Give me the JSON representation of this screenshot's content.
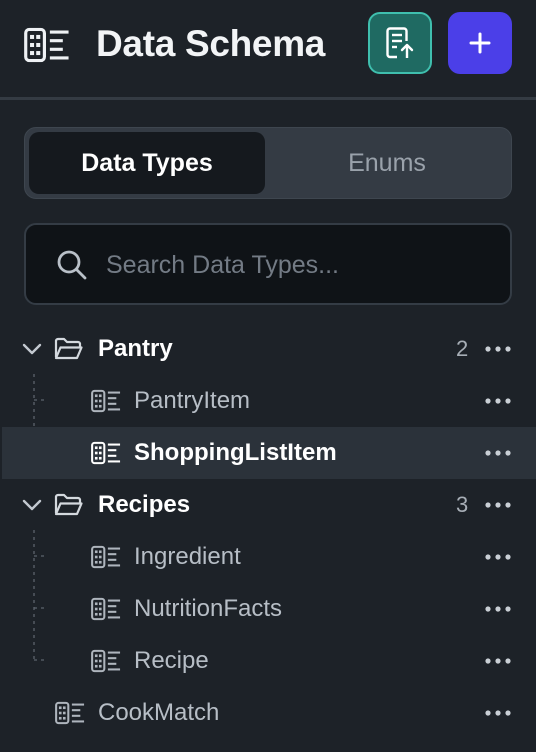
{
  "header": {
    "title": "Data Schema",
    "upload_icon": "document-upload-icon",
    "add_icon": "plus-icon",
    "accent_add": "#4b3fe8",
    "accent_upload": "#3fbfae"
  },
  "tabs": [
    {
      "label": "Data Types",
      "active": true
    },
    {
      "label": "Enums",
      "active": false
    }
  ],
  "search": {
    "placeholder": "Search Data Types...",
    "value": ""
  },
  "tree": {
    "pantry": {
      "label": "Pantry",
      "count": "2",
      "expanded": true,
      "items": [
        {
          "label": "PantryItem",
          "selected": false
        },
        {
          "label": "ShoppingListItem",
          "selected": true
        }
      ]
    },
    "recipes": {
      "label": "Recipes",
      "count": "3",
      "expanded": true,
      "items": [
        {
          "label": "Ingredient",
          "selected": false
        },
        {
          "label": "NutritionFacts",
          "selected": false
        },
        {
          "label": "Recipe",
          "selected": false
        }
      ]
    },
    "root_items": [
      {
        "label": "CookMatch",
        "selected": false
      }
    ]
  }
}
